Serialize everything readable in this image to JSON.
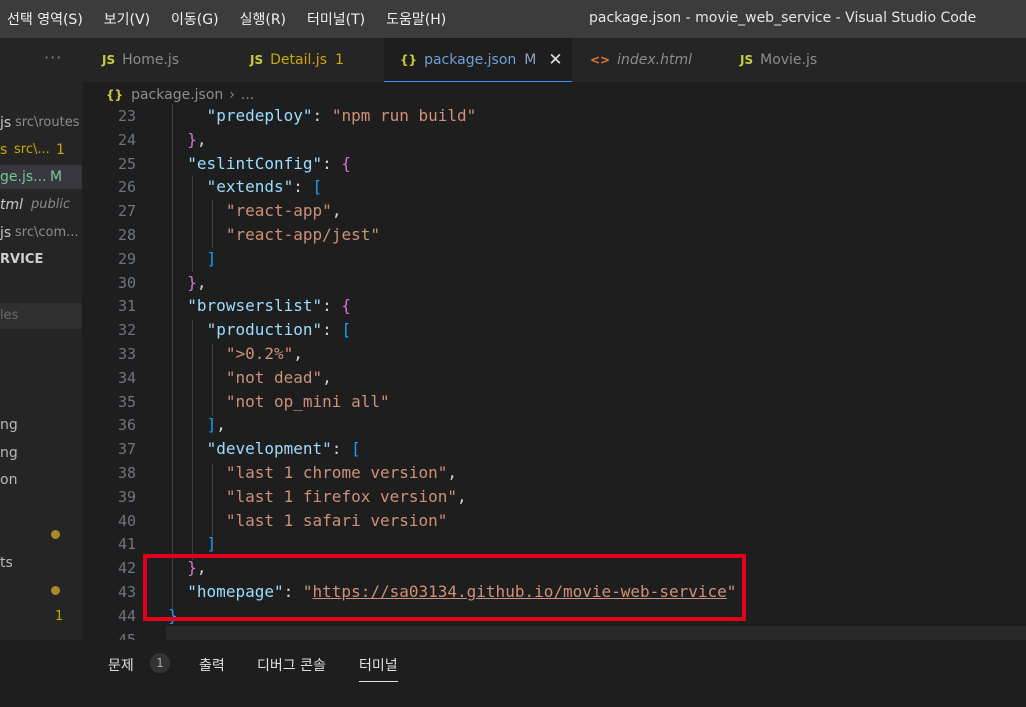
{
  "menu": [
    "선택 영역(S)",
    "보기(V)",
    "이동(G)",
    "실행(R)",
    "터미널(T)",
    "도움말(H)"
  ],
  "window_title": "package.json - movie_web_service - Visual Studio Code",
  "sidebar": {
    "more": "···",
    "open_editors": [
      {
        "name": "js",
        "dir": "src\\routes",
        "badge": ""
      },
      {
        "name": "s",
        "dir": "src\\...",
        "badge": "1"
      },
      {
        "name": "ge.js...",
        "dir": "",
        "badge": "M"
      },
      {
        "name": "tml",
        "dir": "public",
        "badge": ""
      },
      {
        "name": "js",
        "dir": "src\\com...",
        "badge": ""
      }
    ],
    "section": "RVICE",
    "search_placeholder": "les",
    "words": [
      "ng",
      "ng",
      "on",
      "ts"
    ],
    "problem_badge": "1"
  },
  "tabs": [
    {
      "icon": "JS",
      "label": "Home.js",
      "badge": ""
    },
    {
      "icon": "JS",
      "label": "Detail.js",
      "badge": "1"
    },
    {
      "icon": "{}",
      "label": "package.json",
      "badge": "M",
      "close": "✕"
    },
    {
      "icon": "<>",
      "label": "index.html",
      "badge": ""
    },
    {
      "icon": "JS",
      "label": "Movie.js",
      "badge": ""
    }
  ],
  "breadcrumb": {
    "icon": "{}",
    "file": "package.json",
    "sep": "›",
    "more": "..."
  },
  "code": [
    {
      "n": "23",
      "t": "    \"predeploy\": \"npm run build\""
    },
    {
      "n": "24",
      "t": "  },"
    },
    {
      "n": "25",
      "t": "  \"eslintConfig\": {"
    },
    {
      "n": "26",
      "t": "    \"extends\": ["
    },
    {
      "n": "27",
      "t": "      \"react-app\","
    },
    {
      "n": "28",
      "t": "      \"react-app/jest\""
    },
    {
      "n": "29",
      "t": "    ]"
    },
    {
      "n": "30",
      "t": "  },"
    },
    {
      "n": "31",
      "t": "  \"browserslist\": {"
    },
    {
      "n": "32",
      "t": "    \"production\": ["
    },
    {
      "n": "33",
      "t": "      \">0.2%\","
    },
    {
      "n": "34",
      "t": "      \"not dead\","
    },
    {
      "n": "35",
      "t": "      \"not op_mini all\""
    },
    {
      "n": "36",
      "t": "    ],"
    },
    {
      "n": "37",
      "t": "    \"development\": ["
    },
    {
      "n": "38",
      "t": "      \"last 1 chrome version\","
    },
    {
      "n": "39",
      "t": "      \"last 1 firefox version\","
    },
    {
      "n": "40",
      "t": "      \"last 1 safari version\""
    },
    {
      "n": "41",
      "t": "    ]"
    },
    {
      "n": "42",
      "t": "  },"
    },
    {
      "n": "43",
      "t": "  \"homepage\": \"https://sa03134.github.io/movie-web-service\""
    },
    {
      "n": "44",
      "t": "}"
    },
    {
      "n": "45",
      "t": ""
    }
  ],
  "panel": {
    "tabs": [
      "문제",
      "출력",
      "디버그 콘솔",
      "터미널"
    ],
    "problems_count": "1",
    "active": "터미널"
  },
  "colors": {
    "key": "#9cdcfe",
    "string": "#ce9178",
    "bracket_outer": "#da70d6",
    "bracket_inner": "#179fff",
    "highlight": "#e3001b",
    "modified": "#73c991",
    "warning": "#cca700"
  }
}
